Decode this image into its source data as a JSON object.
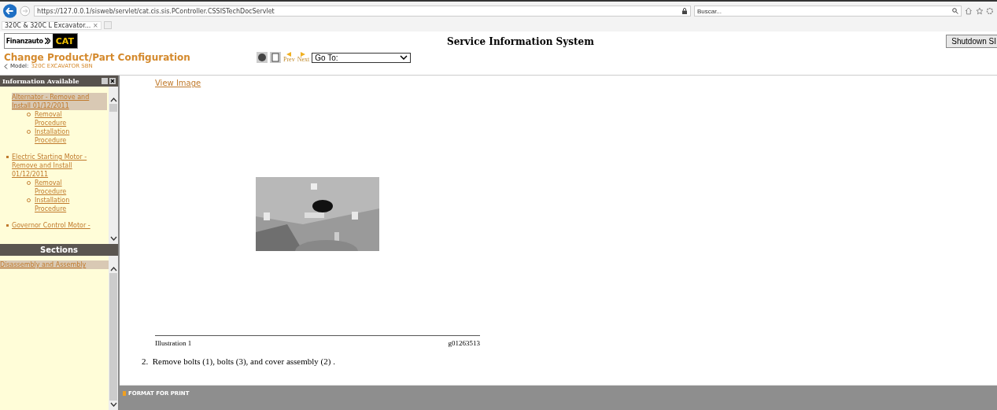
{
  "browser": {
    "url": "https://127.0.0.1/sisweb/servlet/cat.cis.sis.PController.CSSISTechDocServlet",
    "search": {
      "placeholder": "Buscar..."
    },
    "tabs": [
      {
        "label": "320C & 320C L Excavator...",
        "close": "×",
        "selected": true
      }
    ]
  },
  "header": {
    "logo": {
      "brand": "Finanzauto",
      "mark": "CAT"
    },
    "title": "Service Information System",
    "shutdown_button": "Shutdown SI",
    "config_link": "Change Product/Part Configuration",
    "model_label": "Model:",
    "model": "320C EXCAVATOR SBN",
    "prev": "Prev",
    "next": "Next",
    "goto": {
      "value": "Go To:"
    }
  },
  "sidebar": {
    "title": "Information Available",
    "items": [
      {
        "label": "Alternator - Remove and Install 01/12/2011",
        "selected": true,
        "children": [
          {
            "label": "Removal Procedure",
            "selected": false
          },
          {
            "label": "Installation Procedure",
            "selected": false
          }
        ]
      },
      {
        "label": "Electric Starting Motor - Remove and Install 01/12/2011",
        "selected": false,
        "children": [
          {
            "label": "Removal Procedure",
            "selected": false
          },
          {
            "label": "Installation Procedure",
            "selected": false
          }
        ]
      },
      {
        "label": "Governor Control Motor -",
        "selected": false
      }
    ],
    "sections_title": "Sections",
    "sections": [
      {
        "label": "Disassembly and Assembly",
        "selected": true
      }
    ]
  },
  "document": {
    "view_image": "View Image",
    "illustration": {
      "kind": "picture",
      "caption": "Illustration 1",
      "code": "g01263513"
    },
    "step": "2.  Remove bolts (1), bolts (3), and cover assembly (2) ."
  },
  "footer": {
    "format_for_print": "FORMAT FOR PRINT"
  }
}
